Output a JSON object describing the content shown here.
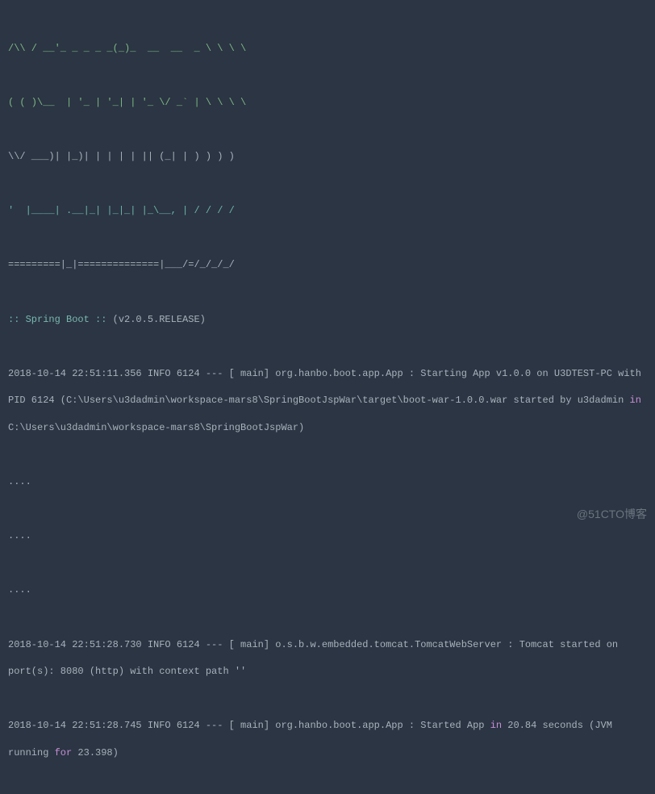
{
  "ascii_art": {
    "line1": "/\\\\ / __'_ _ _ _ _(_)_  __  __  _ \\ \\ \\ \\",
    "line2": "( ( )\\__  | '_ | '_| | '_ \\/ _` | \\ \\ \\ \\",
    "line3": "\\\\/ ___)| |_)| | | | | || (_| | ) ) ) )",
    "line4": "'  |____| .__|_| |_|_| |_\\__, | / / / /",
    "line5": "=========|_|==============|___/=/_/_/_/"
  },
  "spring_boot": {
    "prefix": ":: Spring Boot ::",
    "version": " (v2.0.5.RELEASE)"
  },
  "log1": {
    "timestamp": "2018-10-14 22:51:11.356 INFO 6124 --- [ main] org.hanbo.boot.app.App : Starting App v1.0.0 on U3DTEST-PC with PID 6124 (C:\\Users\\u3dadmin\\workspace-mars8\\SpringBootJspWar\\target\\boot-war-1.0.0.war started by u3dadmin ",
    "keyword": "in",
    "rest": " C:\\Users\\u3dadmin\\workspace-mars8\\SpringBootJspWar)"
  },
  "dots": "....",
  "log2": "2018-10-14 22:51:28.730 INFO 6124 --- [ main] o.s.b.w.embedded.tomcat.TomcatWebServer : Tomcat started on port(s): 8080 (http) with context path ''",
  "log3": {
    "part1": "2018-10-14 22:51:28.745 INFO 6124 --- [ main] org.hanbo.boot.app.App : Started App ",
    "keyword1": "in",
    "part2": " 20.84 seconds (JVM running ",
    "keyword2": "for",
    "part3": " 23.398)"
  },
  "watermark": "@51CTO博客"
}
